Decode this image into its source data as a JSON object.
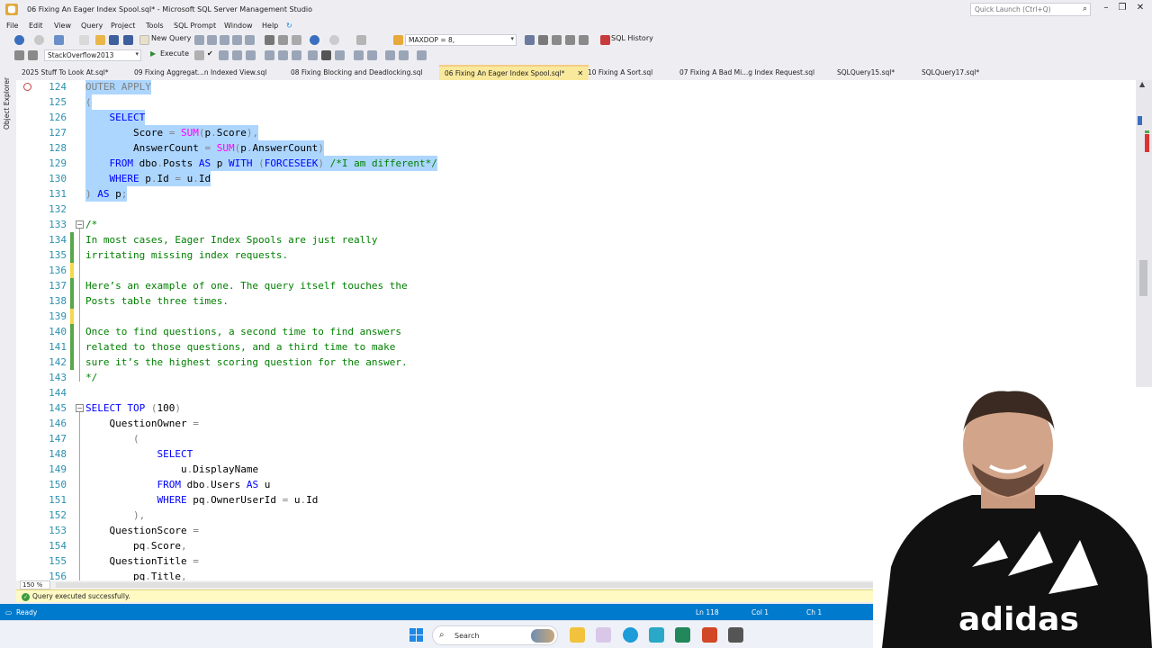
{
  "window": {
    "title": "06 Fixing An Eager Index Spool.sql* - Microsoft SQL Server Management Studio",
    "quick_launch_placeholder": "Quick Launch (Ctrl+Q)"
  },
  "menu": [
    "File",
    "Edit",
    "View",
    "Query",
    "Project",
    "Tools",
    "SQL Prompt",
    "Window",
    "Help"
  ],
  "toolbar": {
    "new_query": "New Query",
    "maxdop_value": "MAXDOP = 8,",
    "sql_history": "SQL History",
    "database": "StackOverflow2013",
    "execute": "Execute"
  },
  "left_strip": {
    "object_explorer": "Object Explorer"
  },
  "tabs": [
    {
      "label": "2025 Stuff To Look At.sql*"
    },
    {
      "label": "09 Fixing Aggregat...n Indexed View.sql"
    },
    {
      "label": "08 Fixing Blocking and Deadlocking.sql"
    },
    {
      "label": "06 Fixing An Eager Index Spool.sql*",
      "active": true
    },
    {
      "label": "10 Fixing A Sort.sql"
    },
    {
      "label": "07 Fixing A Bad Mi...g Index Request.sql"
    },
    {
      "label": "SQLQuery15.sql*"
    },
    {
      "label": "SQLQuery17.sql*"
    }
  ],
  "code": {
    "lines": [
      {
        "n": "124",
        "tokens": [
          {
            "t": "OUTER APPLY",
            "c": "gr"
          }
        ]
      },
      {
        "n": "125",
        "tokens": [
          {
            "t": "(",
            "c": "gr"
          }
        ]
      },
      {
        "n": "126",
        "tokens": [
          {
            "t": "    "
          },
          {
            "t": "SELECT",
            "c": "kw"
          }
        ]
      },
      {
        "n": "127",
        "tokens": [
          {
            "t": "        Score "
          },
          {
            "t": "=",
            "c": "gr"
          },
          {
            "t": " "
          },
          {
            "t": "SUM",
            "c": "fn"
          },
          {
            "t": "(",
            "c": "gr"
          },
          {
            "t": "p"
          },
          {
            "t": ".",
            "c": "gr"
          },
          {
            "t": "Score"
          },
          {
            "t": ")",
            "c": "gr"
          },
          {
            "t": ",",
            "c": "gr"
          }
        ]
      },
      {
        "n": "128",
        "tokens": [
          {
            "t": "        AnswerCount "
          },
          {
            "t": "=",
            "c": "gr"
          },
          {
            "t": " "
          },
          {
            "t": "SUM",
            "c": "fn"
          },
          {
            "t": "(",
            "c": "gr"
          },
          {
            "t": "p"
          },
          {
            "t": ".",
            "c": "gr"
          },
          {
            "t": "AnswerCount"
          },
          {
            "t": ")",
            "c": "gr"
          }
        ]
      },
      {
        "n": "129",
        "tokens": [
          {
            "t": "    "
          },
          {
            "t": "FROM",
            "c": "kw"
          },
          {
            "t": " dbo"
          },
          {
            "t": ".",
            "c": "gr"
          },
          {
            "t": "Posts "
          },
          {
            "t": "AS",
            "c": "kw"
          },
          {
            "t": " p "
          },
          {
            "t": "WITH",
            "c": "kw"
          },
          {
            "t": " "
          },
          {
            "t": "(",
            "c": "gr"
          },
          {
            "t": "FORCESEEK",
            "c": "kw"
          },
          {
            "t": ")",
            "c": "gr"
          },
          {
            "t": " "
          },
          {
            "t": "/*I am different*/",
            "c": "cm"
          }
        ]
      },
      {
        "n": "130",
        "tokens": [
          {
            "t": "    "
          },
          {
            "t": "WHERE",
            "c": "kw"
          },
          {
            "t": " p"
          },
          {
            "t": ".",
            "c": "gr"
          },
          {
            "t": "Id "
          },
          {
            "t": "=",
            "c": "gr"
          },
          {
            "t": " u"
          },
          {
            "t": ".",
            "c": "gr"
          },
          {
            "t": "Id"
          }
        ]
      },
      {
        "n": "131",
        "tokens": [
          {
            "t": ")",
            "c": "gr"
          },
          {
            "t": " "
          },
          {
            "t": "AS",
            "c": "kw"
          },
          {
            "t": " p"
          },
          {
            "t": ";",
            "c": "gr"
          }
        ]
      },
      {
        "n": "132",
        "tokens": []
      },
      {
        "n": "133",
        "tokens": [
          {
            "t": "/*",
            "c": "cm"
          }
        ]
      },
      {
        "n": "134",
        "tokens": [
          {
            "t": "In most cases, Eager Index Spools are just really",
            "c": "cm"
          }
        ]
      },
      {
        "n": "135",
        "tokens": [
          {
            "t": "irritating missing index requests.",
            "c": "cm"
          }
        ]
      },
      {
        "n": "136",
        "tokens": []
      },
      {
        "n": "137",
        "tokens": [
          {
            "t": "Here’s an example of one. The query itself touches the",
            "c": "cm"
          }
        ]
      },
      {
        "n": "138",
        "tokens": [
          {
            "t": "Posts table three times.",
            "c": "cm"
          }
        ]
      },
      {
        "n": "139",
        "tokens": []
      },
      {
        "n": "140",
        "tokens": [
          {
            "t": "Once to find questions, a second time to find answers",
            "c": "cm"
          }
        ]
      },
      {
        "n": "141",
        "tokens": [
          {
            "t": "related to those questions, and a third time to make",
            "c": "cm"
          }
        ]
      },
      {
        "n": "142",
        "tokens": [
          {
            "t": "sure it’s the highest scoring question for the answer.",
            "c": "cm"
          }
        ]
      },
      {
        "n": "143",
        "tokens": [
          {
            "t": "*/",
            "c": "cm"
          }
        ]
      },
      {
        "n": "144",
        "tokens": []
      },
      {
        "n": "145",
        "tokens": [
          {
            "t": "SELECT TOP",
            "c": "kw"
          },
          {
            "t": " "
          },
          {
            "t": "(",
            "c": "gr"
          },
          {
            "t": "100"
          },
          {
            "t": ")",
            "c": "gr"
          }
        ]
      },
      {
        "n": "146",
        "tokens": [
          {
            "t": "    QuestionOwner "
          },
          {
            "t": "=",
            "c": "gr"
          }
        ]
      },
      {
        "n": "147",
        "tokens": [
          {
            "t": "        "
          },
          {
            "t": "(",
            "c": "gr"
          }
        ]
      },
      {
        "n": "148",
        "tokens": [
          {
            "t": "            "
          },
          {
            "t": "SELECT",
            "c": "kw"
          }
        ]
      },
      {
        "n": "149",
        "tokens": [
          {
            "t": "                u"
          },
          {
            "t": ".",
            "c": "gr"
          },
          {
            "t": "DisplayName"
          }
        ]
      },
      {
        "n": "150",
        "tokens": [
          {
            "t": "            "
          },
          {
            "t": "FROM",
            "c": "kw"
          },
          {
            "t": " dbo"
          },
          {
            "t": ".",
            "c": "gr"
          },
          {
            "t": "Users "
          },
          {
            "t": "AS",
            "c": "kw"
          },
          {
            "t": " u"
          }
        ]
      },
      {
        "n": "151",
        "tokens": [
          {
            "t": "            "
          },
          {
            "t": "WHERE",
            "c": "kw"
          },
          {
            "t": " pq"
          },
          {
            "t": ".",
            "c": "gr"
          },
          {
            "t": "OwnerUserId "
          },
          {
            "t": "=",
            "c": "gr"
          },
          {
            "t": " u"
          },
          {
            "t": ".",
            "c": "gr"
          },
          {
            "t": "Id"
          }
        ]
      },
      {
        "n": "152",
        "tokens": [
          {
            "t": "        "
          },
          {
            "t": "),",
            "c": "gr"
          }
        ]
      },
      {
        "n": "153",
        "tokens": [
          {
            "t": "    QuestionScore "
          },
          {
            "t": "=",
            "c": "gr"
          }
        ]
      },
      {
        "n": "154",
        "tokens": [
          {
            "t": "        pq"
          },
          {
            "t": ".",
            "c": "gr"
          },
          {
            "t": "Score"
          },
          {
            "t": ",",
            "c": "gr"
          }
        ]
      },
      {
        "n": "155",
        "tokens": [
          {
            "t": "    QuestionTitle "
          },
          {
            "t": "=",
            "c": "gr"
          }
        ]
      },
      {
        "n": "156",
        "tokens": [
          {
            "t": "        pq"
          },
          {
            "t": ".",
            "c": "gr"
          },
          {
            "t": "Title"
          },
          {
            "t": ",",
            "c": "gr"
          }
        ]
      }
    ]
  },
  "zoom": "150 %",
  "query_status": "Query executed successfully.",
  "statusbar": {
    "ready": "Ready",
    "ln": "Ln 118",
    "col": "Col 1",
    "ch": "Ch 1"
  },
  "taskbar": {
    "search": "Search"
  },
  "colors": {
    "accent": "#007acc",
    "keyword": "#0000ff",
    "comment": "#008000",
    "function": "#ff00ff",
    "selection": "#add6ff",
    "line_number": "#2b91af"
  }
}
